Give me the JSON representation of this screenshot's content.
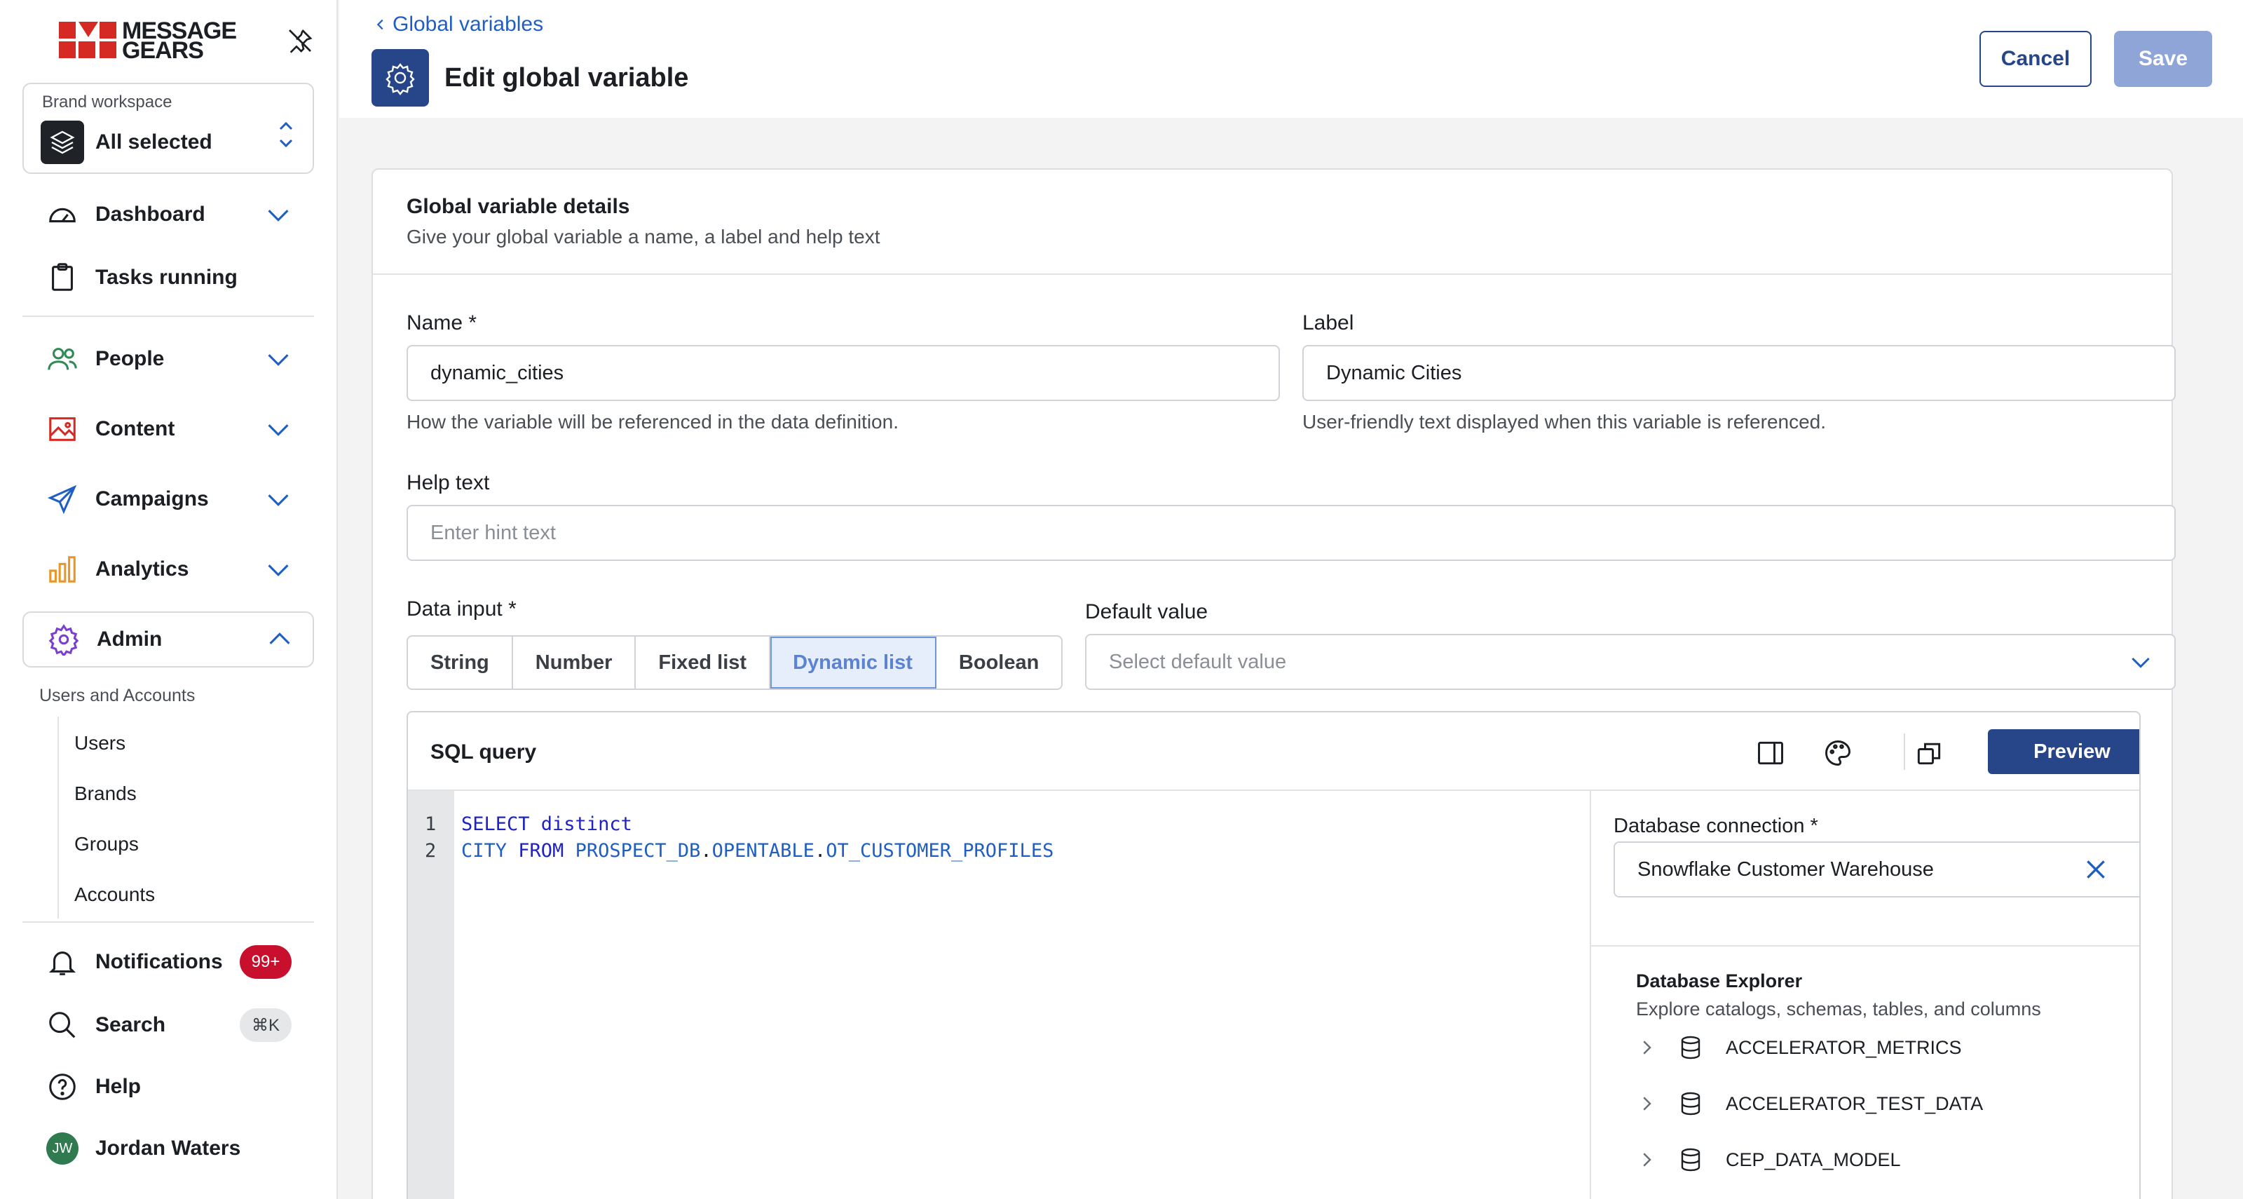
{
  "brand": {
    "logo_line1": "MESSAGE",
    "logo_line2": "GEARS"
  },
  "workspace": {
    "label": "Brand workspace",
    "value": "All selected"
  },
  "nav": {
    "dashboard": "Dashboard",
    "tasks": "Tasks running",
    "people": "People",
    "content": "Content",
    "campaigns": "Campaigns",
    "analytics": "Analytics",
    "admin": "Admin"
  },
  "admin_sub": {
    "heading": "Users and Accounts",
    "items": [
      "Users",
      "Brands",
      "Groups",
      "Accounts"
    ]
  },
  "bottom_nav": {
    "notifications": "Notifications",
    "notifications_badge": "99+",
    "search": "Search",
    "search_shortcut": "⌘K",
    "help": "Help",
    "user_name": "Jordan Waters",
    "user_initials": "JW"
  },
  "header": {
    "breadcrumb": "Global variables",
    "title": "Edit global variable",
    "cancel": "Cancel",
    "save": "Save"
  },
  "card": {
    "title": "Global variable details",
    "subtitle": "Give your global variable a name, a label and help text"
  },
  "form": {
    "name_label": "Name *",
    "name_value": "dynamic_cities",
    "name_hint": "How the variable will be referenced in the data definition.",
    "label_label": "Label",
    "label_value": "Dynamic Cities",
    "label_hint": "User-friendly text displayed when this variable is referenced.",
    "help_label": "Help text",
    "help_placeholder": "Enter hint text",
    "data_input_label": "Data input *",
    "data_input_options": [
      "String",
      "Number",
      "Fixed list",
      "Dynamic list",
      "Boolean"
    ],
    "data_input_selected": "Dynamic list",
    "default_label": "Default value",
    "default_placeholder": "Select default value"
  },
  "sql": {
    "title": "SQL query",
    "preview": "Preview",
    "lines": [
      "1",
      "2"
    ],
    "line1_kw": "SELECT distinct",
    "line2_col": "CITY ",
    "line2_kw": "FROM ",
    "line2_db": "PROSPECT_DB",
    "line2_schema": "OPENTABLE",
    "line2_table": "OT_CUSTOMER_PROFILES",
    "db_connection_label": "Database connection *",
    "db_connection_value": "Snowflake Customer Warehouse",
    "explorer_title": "Database Explorer",
    "explorer_subtitle": "Explore catalogs, schemas, tables, and columns",
    "catalogs": [
      "ACCELERATOR_METRICS",
      "ACCELERATOR_TEST_DATA",
      "CEP_DATA_MODEL"
    ]
  },
  "colors": {
    "brand_red": "#d42a23",
    "primary": "#27468a",
    "link": "#1f5fc4",
    "badge_red": "#c8102e"
  }
}
